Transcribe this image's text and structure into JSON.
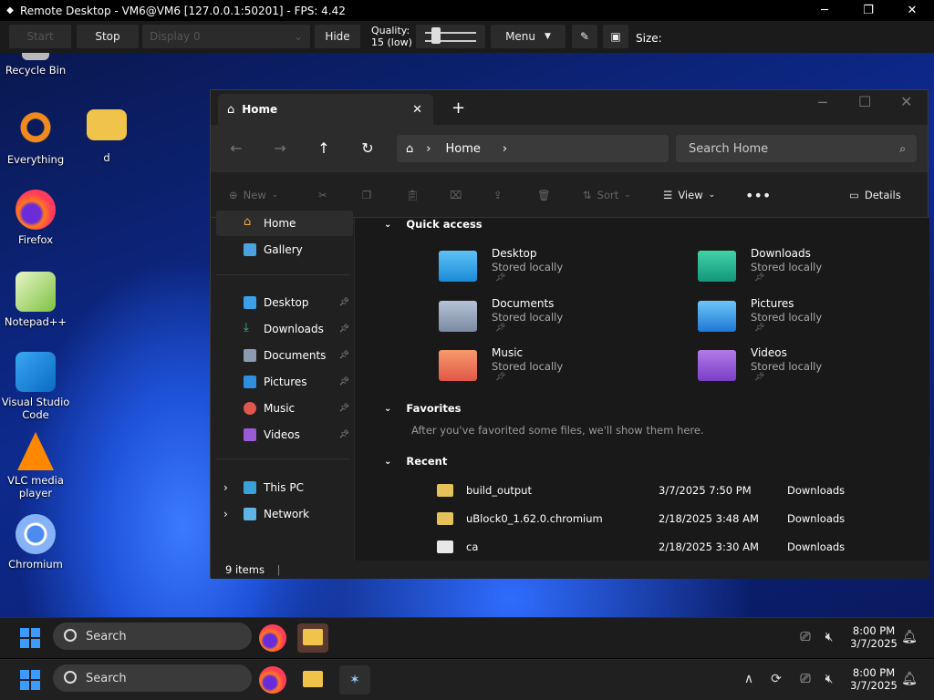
{
  "rd": {
    "title": "Remote Desktop - VM6@VM6 [127.0.0.1:50201] - FPS: 4.42",
    "start": "Start",
    "stop": "Stop",
    "display": "Display 0",
    "hide": "Hide",
    "quality_label": "Quality:",
    "quality_value": "15 (low)",
    "quality_level": 0.15,
    "menu": "Menu",
    "size": "Size:"
  },
  "desktop": {
    "icons": [
      {
        "label": "Recycle Bin"
      },
      {
        "label": "Everything"
      },
      {
        "label": "d"
      },
      {
        "label": "Firefox"
      },
      {
        "label": "Notepad++"
      },
      {
        "label": "Visual Studio Code"
      },
      {
        "label": "VLC media player"
      },
      {
        "label": "Chromium"
      }
    ]
  },
  "explorer": {
    "tab_title": "Home",
    "breadcrumb": "Home",
    "search_placeholder": "Search Home",
    "cmd": {
      "new": "New",
      "sort": "Sort",
      "view": "View",
      "details": "Details"
    },
    "sidebar": [
      {
        "label": "Home"
      },
      {
        "label": "Gallery"
      },
      {
        "label": "Desktop"
      },
      {
        "label": "Downloads"
      },
      {
        "label": "Documents"
      },
      {
        "label": "Pictures"
      },
      {
        "label": "Music"
      },
      {
        "label": "Videos"
      },
      {
        "label": "This PC"
      },
      {
        "label": "Network"
      }
    ],
    "quick_access_title": "Quick access",
    "quick_access": [
      {
        "name": "Desktop",
        "sub": "Stored locally"
      },
      {
        "name": "Downloads",
        "sub": "Stored locally"
      },
      {
        "name": "Documents",
        "sub": "Stored locally"
      },
      {
        "name": "Pictures",
        "sub": "Stored locally"
      },
      {
        "name": "Music",
        "sub": "Stored locally"
      },
      {
        "name": "Videos",
        "sub": "Stored locally"
      }
    ],
    "favorites_title": "Favorites",
    "favorites_empty": "After you've favorited some files, we'll show them here.",
    "recent_title": "Recent",
    "recent": [
      {
        "name": "build_output",
        "date": "3/7/2025 7:50 PM",
        "location": "Downloads"
      },
      {
        "name": "uBlock0_1.62.0.chromium",
        "date": "2/18/2025 3:48 AM",
        "location": "Downloads"
      },
      {
        "name": "ca",
        "date": "2/18/2025 3:30 AM",
        "location": "Downloads"
      }
    ],
    "status": "9 items"
  },
  "taskbar_inner": {
    "search": "Search",
    "time": "8:00 PM",
    "date": "3/7/2025"
  },
  "taskbar_outer": {
    "search": "Search",
    "time": "8:00 PM",
    "date": "3/7/2025"
  }
}
